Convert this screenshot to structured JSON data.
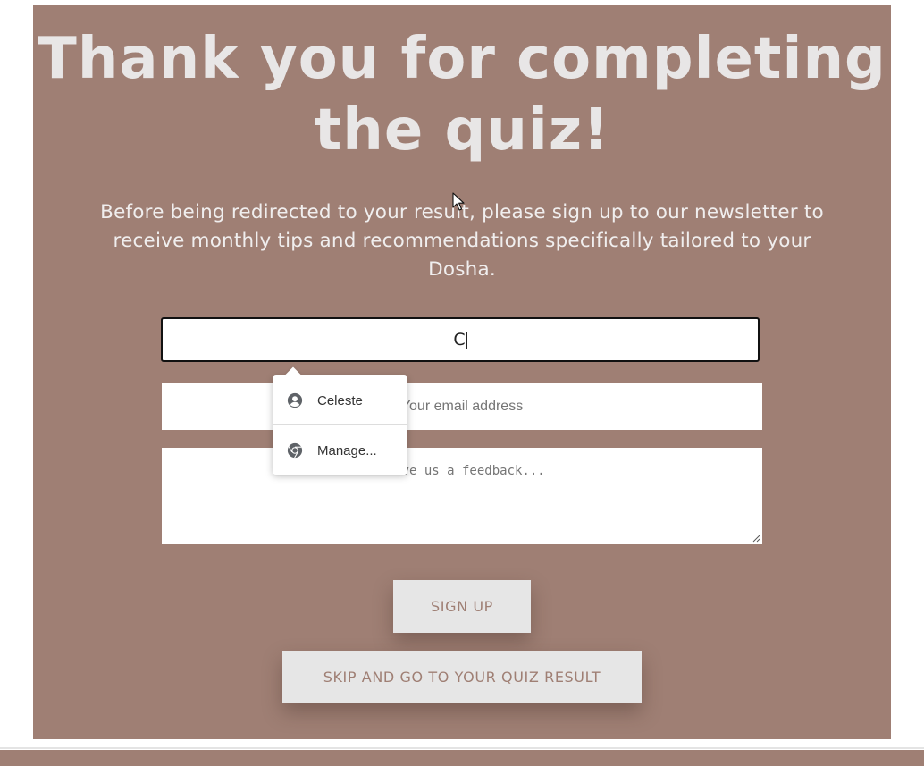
{
  "page": {
    "heading": "Thank you for completing the quiz!",
    "intro_text": "Before being redirected to your result, please sign up to our newsletter to receive monthly tips and recommendations specifically tailored to your Dosha."
  },
  "form": {
    "name_value": "C",
    "email_placeholder": "Your email address",
    "feedback_placeholder": "Leave us a feedback...",
    "signup_label": "SIGN UP",
    "skip_label": "SKIP AND GO TO YOUR QUIZ RESULT"
  },
  "autofill": {
    "items": [
      {
        "label": "Celeste",
        "icon": "account-circle-icon"
      },
      {
        "label": "Manage...",
        "icon": "chrome-icon"
      }
    ]
  },
  "colors": {
    "panel_background": "#9f7f74",
    "heading_text": "#e8e6e6",
    "button_background": "#e6e6e6",
    "button_text": "#9f7f74"
  }
}
